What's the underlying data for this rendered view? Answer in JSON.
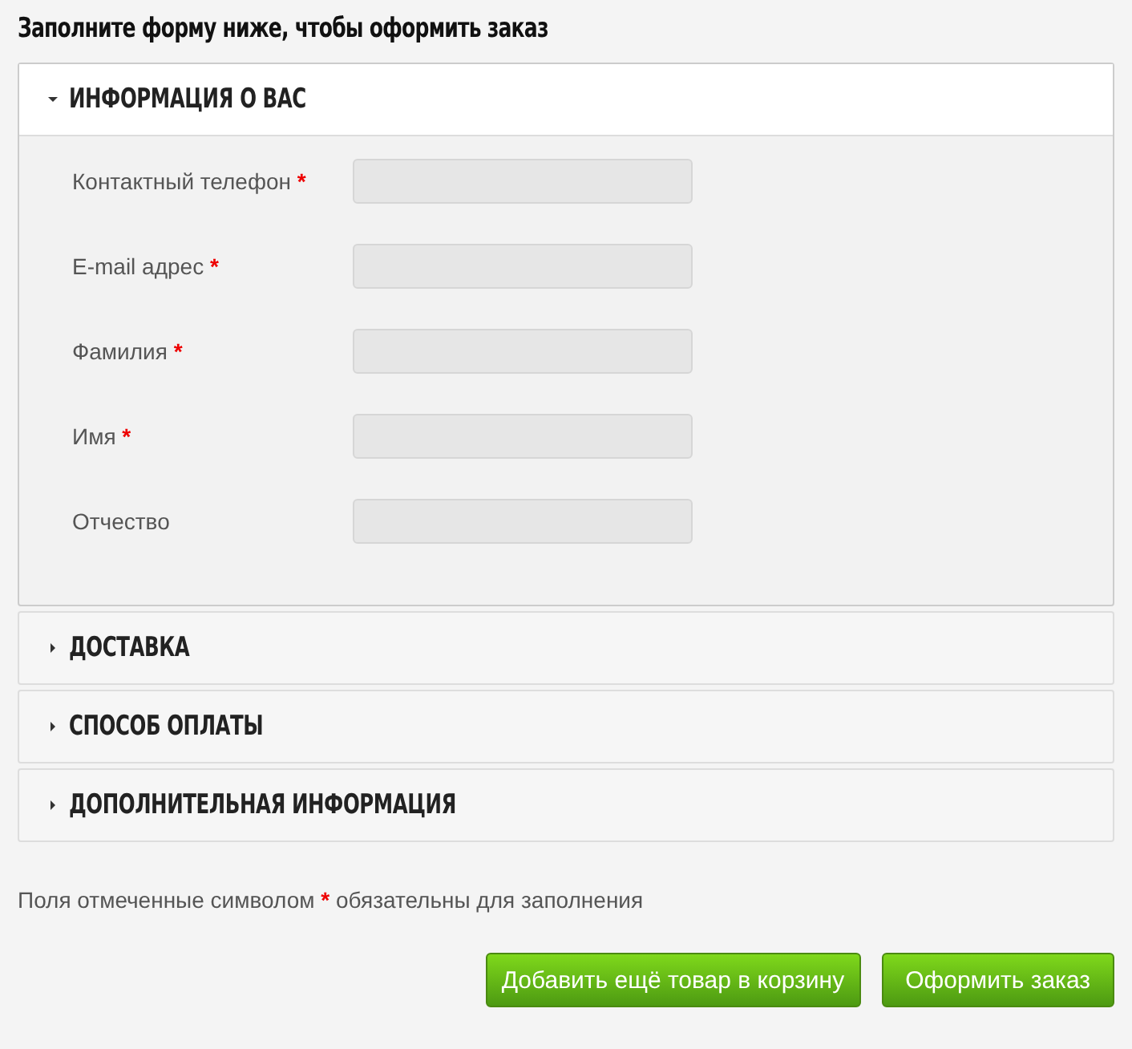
{
  "title": "Заполните форму ниже, чтобы оформить заказ",
  "sections": [
    {
      "title": "ИНФОРМАЦИЯ О ВАС",
      "expanded": true,
      "fields": [
        {
          "label": "Контактный телефон",
          "mark": "*"
        },
        {
          "label": "E-mail адрес",
          "mark": "*"
        },
        {
          "label": "Фамилия",
          "mark": "*"
        },
        {
          "label": "Имя",
          "mark": "*"
        },
        {
          "label": "Отчество"
        }
      ]
    },
    {
      "title": "ДОСТАВКА",
      "expanded": false
    },
    {
      "title": "СПОСОБ ОПЛАТЫ",
      "expanded": false
    },
    {
      "title": "ДОПОЛНИТЕЛЬНАЯ ИНФОРМАЦИЯ",
      "expanded": false
    }
  ],
  "note": {
    "before": "Поля отмеченные символом",
    "mark": "*",
    "after": "обязательны для заполнения"
  },
  "buttons": [
    "Добавить ещё товар в корзину",
    "Оформить заказ"
  ]
}
